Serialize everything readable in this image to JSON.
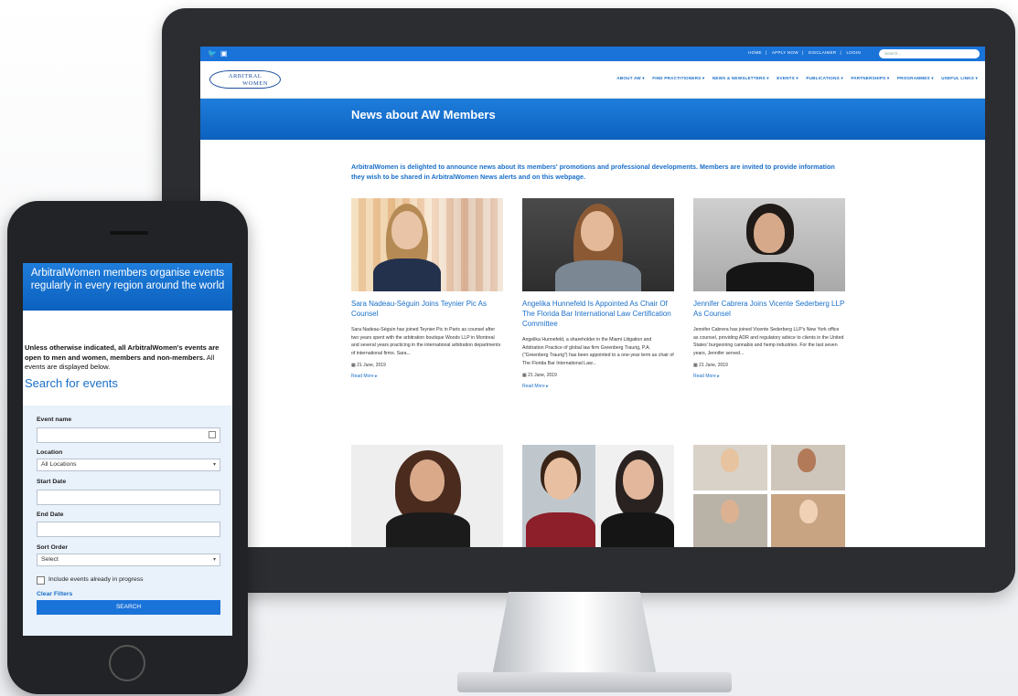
{
  "desktop": {
    "top_links": [
      "HOME",
      "APPLY NOW",
      "DISCLAIMER",
      "LOGIN"
    ],
    "search_placeholder": "Search...",
    "logo_line1": "ARBITRAL",
    "logo_line2": "WOMEN",
    "nav": [
      "ABOUT AW ▾",
      "FIND PRACTITIONERS ▾",
      "NEWS & NEWSLETTERS ▾",
      "EVENTS ▾",
      "PUBLICATIONS ▾",
      "PARTNERSHIPS ▾",
      "PROGRAMMES ▾",
      "USEFUL LINKS ▾"
    ],
    "page_title": "News about AW Members",
    "intro": "ArbitralWomen is delighted to announce news about its members' promotions and professional developments. Members are invited to provide information they wish to be shared in ArbitralWomen News alerts and on this webpage.",
    "cards": [
      {
        "title": "Sara Nadeau-Séguin Joins Teynier Pic As Counsel",
        "text": "Sara Nadeau-Séguin has joined Teynier Pic in Paris as counsel after two years spent with the arbitration boutique Woods LLP in Montreal and several years practicing in the international arbitration departments of international firms. Sara...",
        "date": "21 June, 2019",
        "more": "Read More ▸"
      },
      {
        "title": "Angelika Hunnefeld Is Appointed As Chair Of The Florida Bar International Law Certification Committee",
        "text": "Angelika Hunnefeld, a shareholder in the Miami Litigation and Arbitration Practice of global law firm Greenberg Traurig, P.A. (\"Greenberg Traurig\") has been appointed to a one-year term as chair of The Florida Bar International Law...",
        "date": "21 June, 2019",
        "more": "Read More ▸"
      },
      {
        "title": "Jennifer Cabrera Joins Vicente Sederberg LLP As Counsel",
        "text": "Jennifer Cabrera has joined Vicente Sederberg LLP's New York office as counsel, providing ADR and regulatory advice to clients in the United States' burgeoning cannabis and hemp industries. For the last seven years, Jennifer served...",
        "date": "21 June, 2019",
        "more": "Read More ▸"
      }
    ]
  },
  "phone": {
    "banner": "ArbitralWomen members organise events regularly in every region around the world",
    "note_bold": "Unless otherwise indicated, all ArbitralWomen's events are open to men and women, members and non-members.",
    "note_rest": " All events are displayed below.",
    "search_title": "Search for events",
    "event_name_label": "Event name",
    "event_name_value": "",
    "location_label": "Location",
    "location_value": "All Locations",
    "start_date_label": "Start Date",
    "end_date_label": "End Date",
    "sort_label": "Sort Order",
    "sort_value": "Select",
    "include_label": "Include events already in progress",
    "clear_label": "Clear Filters",
    "search_button": "SEARCH"
  },
  "colors": {
    "brand_blue": "#1a73d9",
    "link_blue": "#1a6fc9",
    "bezel": "#2b2d31"
  }
}
